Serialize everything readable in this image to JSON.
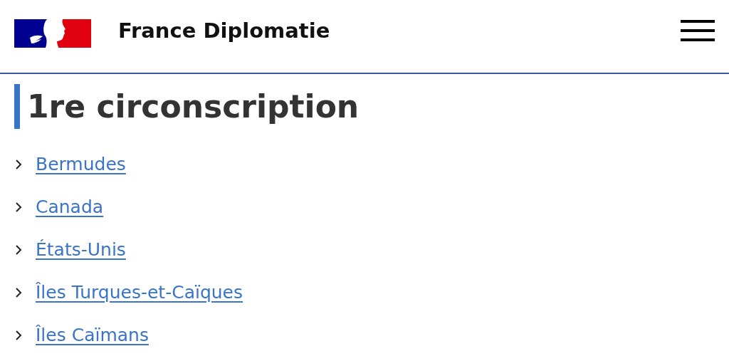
{
  "header": {
    "title": "France Diplomatie"
  },
  "heading": "1re circonscription",
  "links": [
    {
      "label": "Bermudes"
    },
    {
      "label": "Canada"
    },
    {
      "label": "États-Unis"
    },
    {
      "label": "Îles Turques-et-Caïques"
    },
    {
      "label": "Îles Caïmans"
    }
  ]
}
